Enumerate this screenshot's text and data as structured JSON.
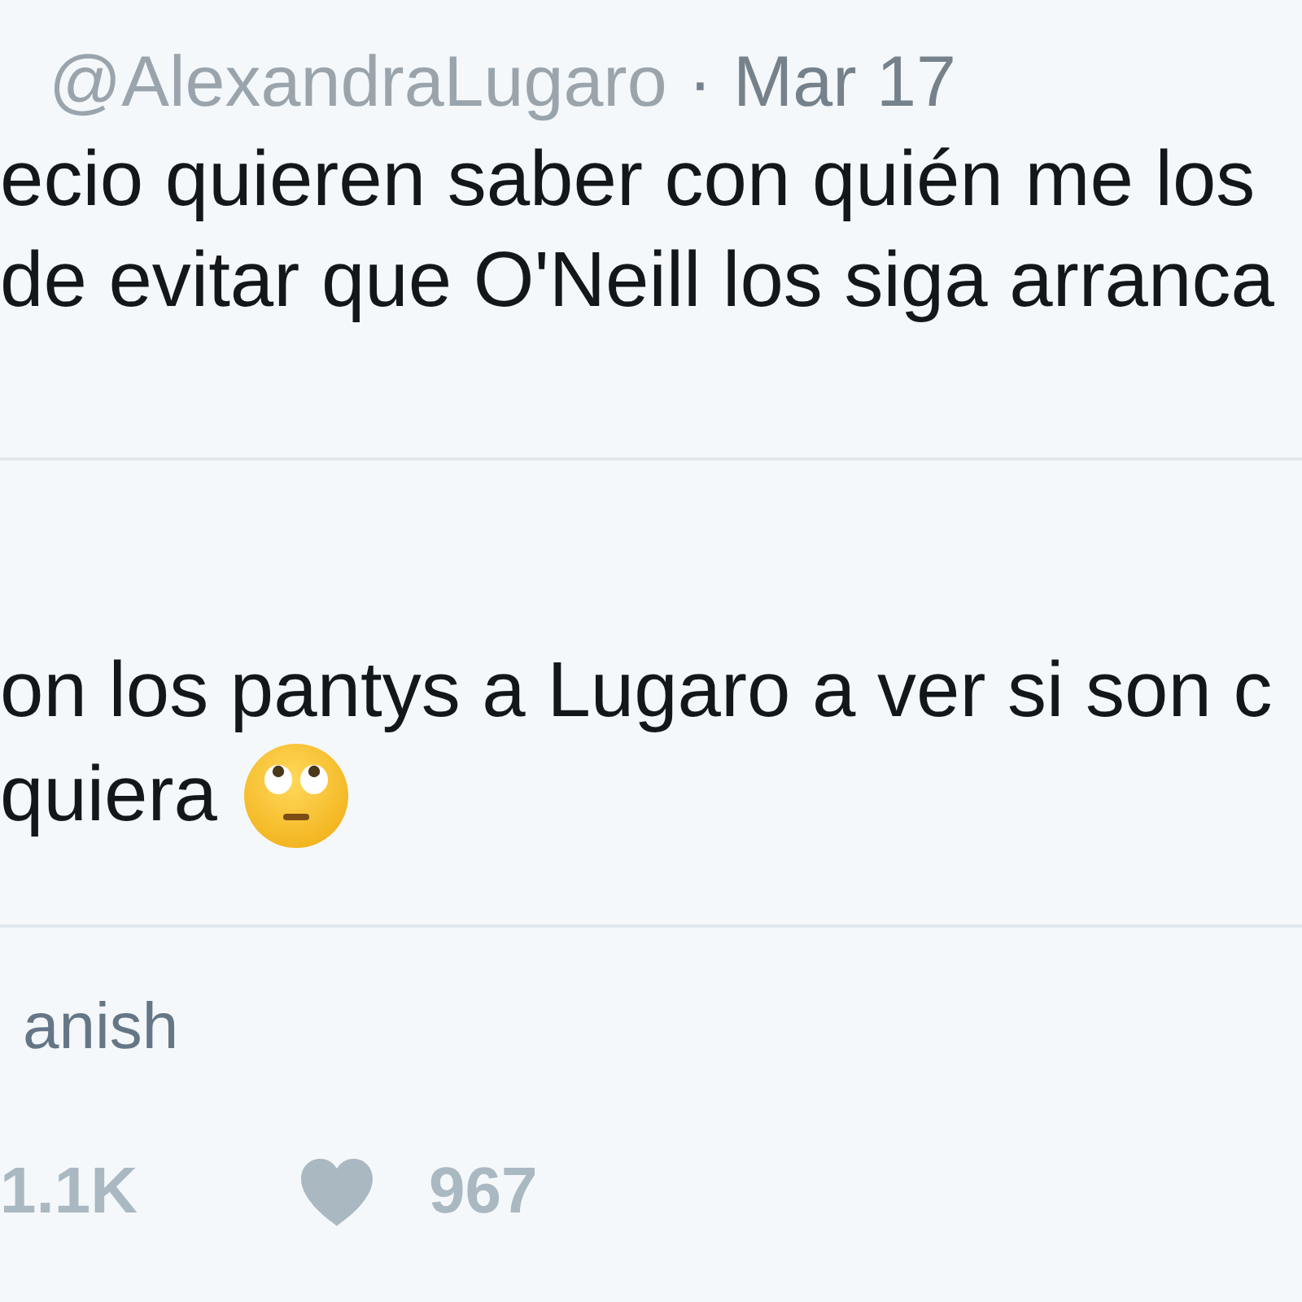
{
  "tweet": {
    "handle": "@AlexandraLugaro",
    "separator": "·",
    "date": "Mar 17",
    "text_lines": [
      "ecio quieren saber con quién me los",
      "de evitar que O'Neill los siga arranca"
    ]
  },
  "reply": {
    "text_lines": [
      "on los pantys a Lugaro a ver si son c",
      "quiera"
    ]
  },
  "translate": {
    "label": "anish"
  },
  "stats": {
    "first_count": "1.1K",
    "likes": "967",
    "liked": false
  }
}
